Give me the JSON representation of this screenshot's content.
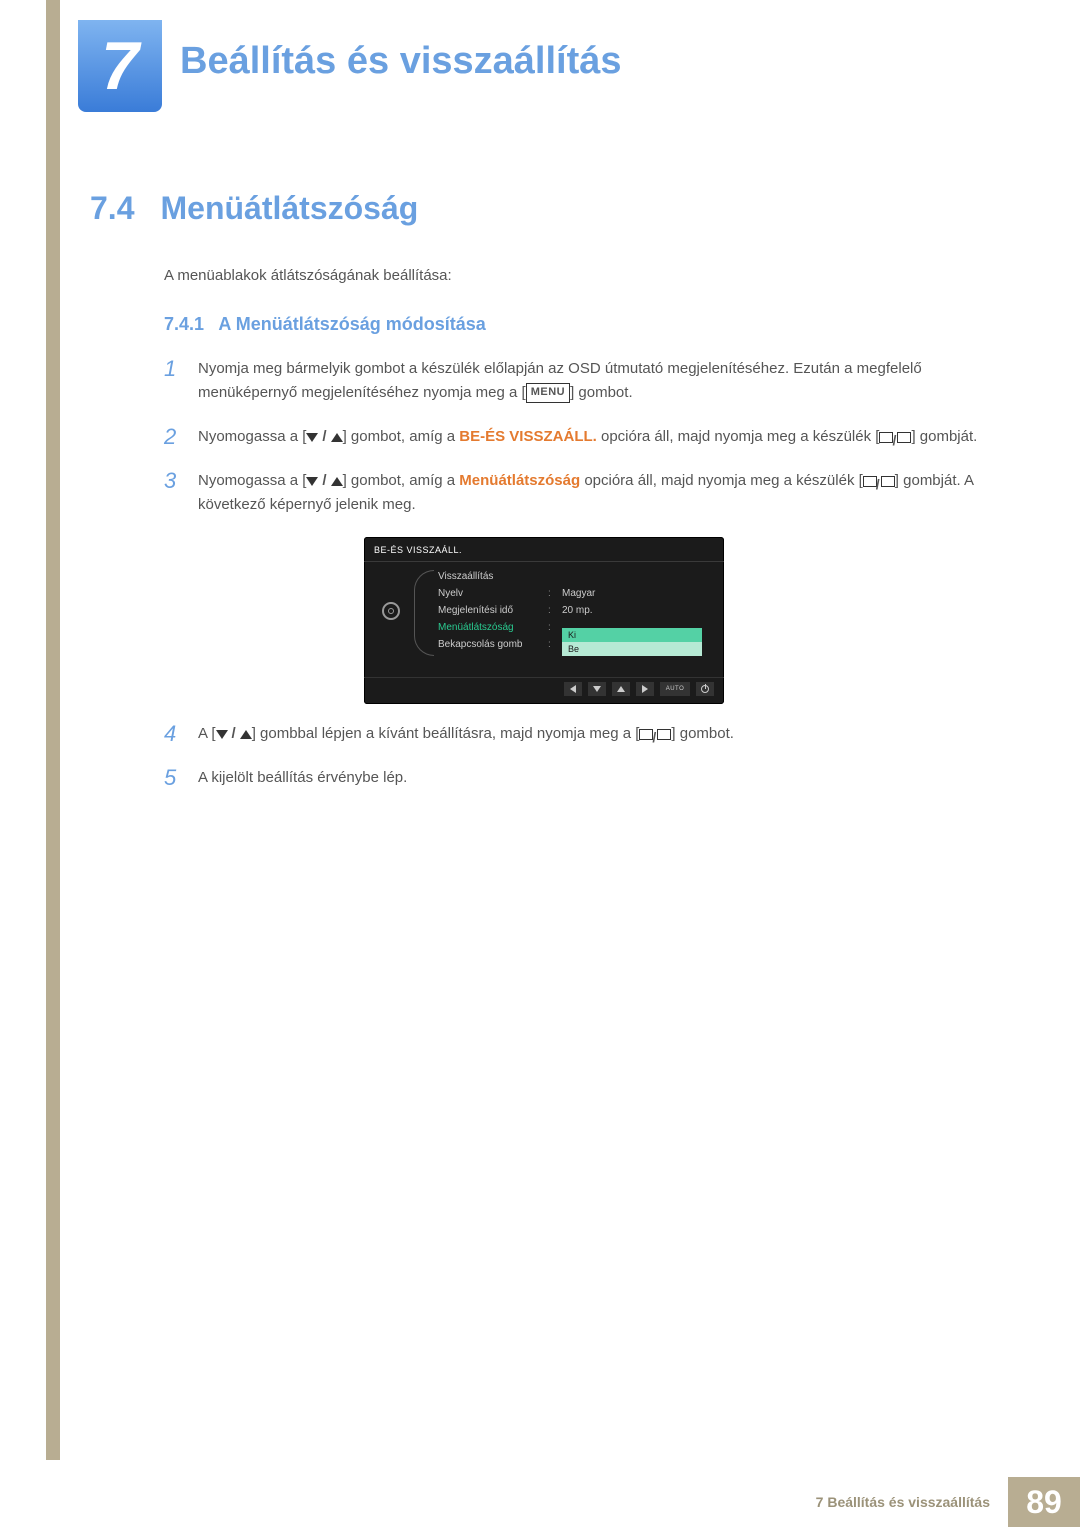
{
  "chapter": {
    "number": "7",
    "title": "Beállítás és visszaállítás"
  },
  "section": {
    "number": "7.4",
    "title": "Menüátlátszóság"
  },
  "intro": "A menüablakok átlátszóságának beállítása:",
  "subsection": {
    "number": "7.4.1",
    "title": "A Menüátlátszóság módosítása"
  },
  "steps": {
    "s1a": "Nyomja meg bármelyik gombot a készülék előlapján az OSD útmutató megjelenítéséhez. Ezután a megfelelő menüképernyő megjelenítéséhez nyomja meg a [",
    "s1b": "] gombot.",
    "menu_label": "MENU",
    "s2a": "Nyomogassa a [",
    "s2b": "] gombot, amíg a ",
    "s2c": "BE-ÉS VISSZAÁLL.",
    "s2d": " opcióra áll, majd nyomja meg a készülék [",
    "s2e": "] gombját.",
    "s3a": "Nyomogassa a [",
    "s3b": "] gombot, amíg a ",
    "s3c": "Menüátlátszóság",
    "s3d": " opcióra áll, majd nyomja meg a készülék [",
    "s3e": "] gombját. A következő képernyő jelenik meg.",
    "s4a": "A [",
    "s4b": "] gombbal lépjen a kívánt beállításra, majd nyomja meg a [",
    "s4c": "] gombot.",
    "s5": "A kijelölt beállítás érvénybe lép."
  },
  "osd": {
    "title": "BE-ÉS VISSZAÁLL.",
    "rows": [
      {
        "label": "Visszaállítás",
        "value": ""
      },
      {
        "label": "Nyelv",
        "value": "Magyar"
      },
      {
        "label": "Megjelenítési idő",
        "value": "20 mp."
      },
      {
        "label": "Menüátlátszóság",
        "value": "",
        "highlight": true
      },
      {
        "label": "Bekapcsolás gomb",
        "value": ""
      }
    ],
    "options": {
      "opt1": "Ki",
      "opt2": "Be"
    },
    "nav_auto": "AUTO"
  },
  "footer": {
    "text": "7 Beállítás és visszaállítás",
    "page": "89"
  }
}
